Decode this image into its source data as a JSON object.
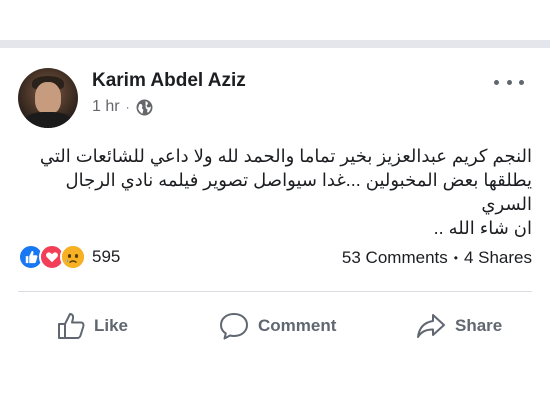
{
  "post": {
    "author": "Karim Abdel Aziz",
    "time": "1 hr",
    "meta_separator": "·",
    "privacy_icon": "globe-icon",
    "body": "النجم كريم عبدالعزيز بخير تماما والحمد لله ولا داعي للشائعات التي\nيطلقها بعض المخبولين ...غدا سيواصل تصوير فيلمه نادي الرجال السري\nان شاء الله ..",
    "reactions": {
      "icons": [
        "like-icon",
        "love-icon",
        "sad-icon"
      ],
      "count": "595"
    },
    "comments": "53 Comments",
    "stats_separator": "•",
    "shares": "4 Shares"
  },
  "actions": {
    "like": "Like",
    "comment": "Comment",
    "share": "Share"
  },
  "colors": {
    "like_blue": "#1877f2",
    "love_red": "#f33e58",
    "sad_yellow": "#f7b125",
    "action_grey": "#606770",
    "divider": "#dadde1",
    "top_band": "#e4e6eb"
  }
}
